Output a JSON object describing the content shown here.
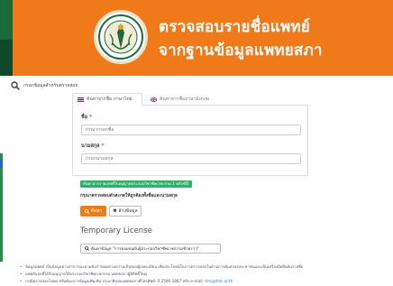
{
  "header": {
    "title_line1": "ตรวจสอบรายชื่อแพทย์",
    "title_line2": "จากฐานข้อมูลแพทยสภา",
    "bg_color": "#f07a1a"
  },
  "search_heading": {
    "icon": "search-icon",
    "label": "กรอกข้อมูลสำหรับตรวจสอบ"
  },
  "tabs": [
    {
      "label": "ค้นหาจากชื่อ ภาษาไทย",
      "icon": "thai-flag-icon",
      "active": true
    },
    {
      "label": "ค้นหาจากชื่อภาษาอังกฤษ",
      "icon": "uk-flag-icon",
      "active": false
    }
  ],
  "form": {
    "first_name": {
      "label": "ชื่อ",
      "required": "*",
      "placeholder": "กรุณากรอกชื่อ",
      "value": ""
    },
    "last_name": {
      "label": "นามสกุล",
      "required": "*",
      "placeholder": "กรอกนามสกุล",
      "value": ""
    }
  },
  "badge": "ค้นหาจากรายเลขที่ใบอนุญาตประกอบวิชาชีพเวชกรรม 1 หลักซ์นี้",
  "note": "กรุณาตรวจสอบตัวสะกดให้ถูกต้องทั้งชื่อและนามสกุล",
  "buttons": {
    "search": "ค้นหา",
    "clear": "ล้างข้อมูล",
    "search_color": "#ef7d16"
  },
  "temporary": {
    "title": "Temporary License",
    "button": "ค้นหาข้อมูล \"การขอผ่อนผันผู้ประกอบวิชาชีพเวชกรรมชั่วคราว\""
  },
  "info": [
    {
      "text": "ข้อมูลแพทย์ เป็นข้อมูลทางสาธารณะตามข้อกำหนดตามความเป็นของผู้ลงทะเบียน เพื่อประโยชน์ในการตรวจสอบในด้านการคุ้มครองประชาชนและเป็นเครื่องมือยืนยันรายชื่อ",
      "link": ""
    },
    {
      "text": "แพทย์บอกที่ได้รับอนุญาตให้ประกอบวิชาชีพเวชกรรม แพทยสภาผู้มีสิทธิ์ใหญ่",
      "link": ""
    },
    {
      "text": "กรณีตรวจสอบไม่พบ หรือต้องการข้อมูลเพิ่มเติม กรุณาติดต่อแพทยสภาที่โทรศัพท์: 0 2590 1887 หรือ e-mail:",
      "link": "tmc@tmc.or.th"
    }
  ]
}
